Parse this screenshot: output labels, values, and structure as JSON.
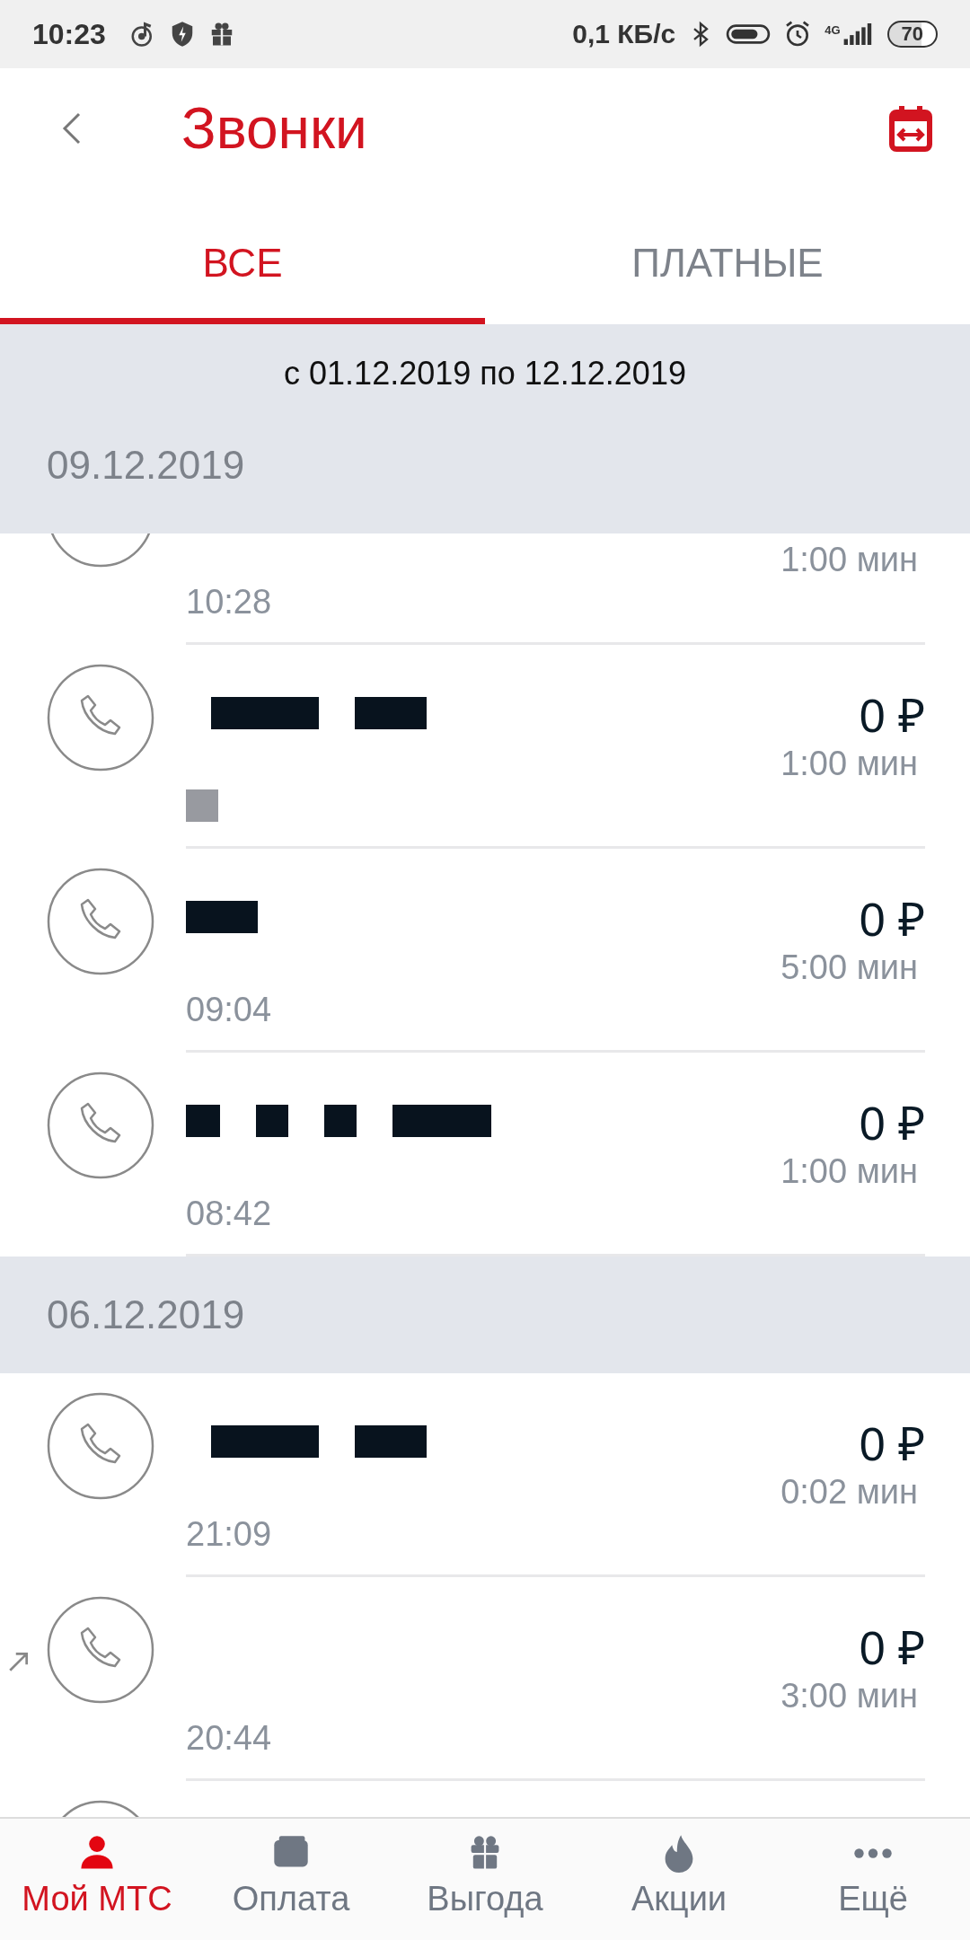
{
  "status_bar": {
    "time": "10:23",
    "speed": "0,1 КБ/с",
    "network": "4G",
    "battery": "70"
  },
  "header": {
    "title": "Звонки"
  },
  "tabs": [
    {
      "label": "ВСЕ",
      "selected": true
    },
    {
      "label": "ПЛАТНЫЕ",
      "selected": false
    }
  ],
  "period": "с 01.12.2019 по 12.12.2019",
  "sections": [
    {
      "date": "09.12.2019",
      "calls": [
        {
          "kind": "clipped",
          "duration": "1:00 мин",
          "time": "10:28"
        },
        {
          "kind": "full",
          "number_hidden": true,
          "outgoing": false,
          "amount": "0 ₽",
          "duration": "1:00 мин"
        },
        {
          "kind": "full",
          "number_hidden": true,
          "outgoing": false,
          "amount": "0 ₽",
          "duration": "5:00 мин",
          "time": "09:04"
        },
        {
          "kind": "full",
          "number_hidden": true,
          "outgoing": false,
          "amount": "0 ₽",
          "duration": "1:00 мин",
          "time": "08:42"
        }
      ]
    },
    {
      "date": "06.12.2019",
      "calls": [
        {
          "kind": "full",
          "number_hidden": true,
          "outgoing": false,
          "amount": "0 ₽",
          "duration": "0:02 мин",
          "time": "21:09"
        },
        {
          "kind": "full",
          "number_hidden": false,
          "outgoing": true,
          "amount": "0 ₽",
          "duration": "3:00 мин",
          "time": "20:44"
        },
        {
          "kind": "full"
        }
      ]
    }
  ],
  "nav": [
    {
      "label": "Мой МТС",
      "selected": true
    },
    {
      "label": "Оплата",
      "selected": false
    },
    {
      "label": "Выгода",
      "selected": false
    },
    {
      "label": "Акции",
      "selected": false
    },
    {
      "label": "Ещё",
      "selected": false
    }
  ]
}
